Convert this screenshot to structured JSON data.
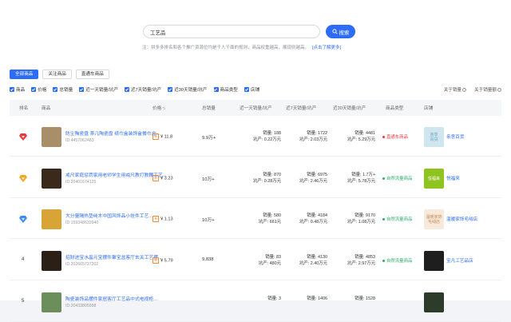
{
  "search": {
    "value": "工艺品",
    "button": "搜索"
  },
  "tip": {
    "text": "注：拼多多排名和各个推广资源位均是千人千面的规则，商品权重越高，展现则越高。",
    "link": "[点击了解更多]"
  },
  "tabs": [
    {
      "label": "全部商品",
      "active": true
    },
    {
      "label": "关注商品",
      "active": false
    },
    {
      "label": "直通车商品",
      "active": false
    }
  ],
  "filters": {
    "items": [
      "商品",
      "价格",
      "总销量",
      "近一天销量/坑产",
      "近7天销量/坑产",
      "近30天销量/坑产",
      "商品类型",
      "店铺"
    ],
    "right": [
      "关于销量",
      "关于销量额"
    ]
  },
  "table": {
    "headers": {
      "rank": "排名",
      "product": "商品",
      "price": "价格",
      "total": "总销量",
      "d1": "近一天销量/坑产",
      "d7": "近7天销量/坑产",
      "d30": "近30天销量/坑产",
      "type": "商品类型",
      "shop": "店铺"
    },
    "rows": [
      {
        "rank": "1",
        "rank_style": "red",
        "thumb_color": "#a98e6a",
        "title": "防尘陶瓷盘 茶几陶瓷盘 纸巾盒装饰盒餐巾盒...",
        "id": "ID:4457062483",
        "price_tag": "券",
        "price": "¥ 11.8",
        "total": "9.9万+",
        "d1_sales": "销量: 188",
        "d1_output": "坑产: 0.22万元",
        "d7_sales": "销量: 1722",
        "d7_output": "坑产: 2.03万元",
        "d30_sales": "销量: 4481",
        "d30_output": "坑产: 5.29万元",
        "type": "直通车商品",
        "type_color": "#e8383d",
        "shop_logo": "亲意\n百货",
        "shop_logo_bg": "#cfe6ef",
        "shop_logo_fg": "#6fa9c6",
        "shop": "亲意百货"
      },
      {
        "rank": "2",
        "rank_style": "orange",
        "thumb_color": "#3a2a1c",
        "title": "戒尺家庭惩罚家用老师学生用戒尺教打教鞭工艺...",
        "id": "ID:204016741​25",
        "price_tag": "券",
        "price": "¥ 3.23",
        "total": "10万+",
        "d1_sales": "销量: 870",
        "d1_output": "坑产: 0.28万元",
        "d7_sales": "销量: 6975",
        "d7_output": "坑产: 2.46万元",
        "d30_sales": "销量: 1.7万+",
        "d30_output": "坑产: 5.78万元",
        "type": "自然流量商品",
        "type_color": "#2fae6b",
        "shop_logo": "悦福来",
        "shop_logo_bg": "#8fc31f",
        "shop_logo_fg": "#ffffff",
        "shop": "悦福来"
      },
      {
        "rank": "3",
        "rank_style": "blue",
        "thumb_color": "#d9a436",
        "title": "大分量隔热垫纯木中国风饰品小挂件工艺...",
        "id": "ID:159348633940",
        "price_tag": "券",
        "price": "¥ 1.13",
        "total": "10万+",
        "d1_sales": "销量: 580",
        "d1_output": "坑产: 661元",
        "d7_sales": "销量: 4184",
        "d7_output": "坑产: 0.48万元",
        "d30_sales": "销量: 9170",
        "d30_output": "坑产: 1.08万元",
        "type": "自然流量商品",
        "type_color": "#2fae6b",
        "shop_logo": "温暖家饰\n毛绒店",
        "shop_logo_bg": "#f7e9dc",
        "shop_logo_fg": "#c98a5a",
        "shop": "温暖家饰毛绒店"
      },
      {
        "rank": "4",
        "rank_style": "plain",
        "thumb_color": "#2a2016",
        "title": "招财进宝水晶元宝摆件聚宝盆客厅玄关工艺摆...",
        "id": "ID:202665727202",
        "price_tag": "券",
        "price": "¥ 5.79",
        "total": "9,838",
        "d1_sales": "销量: 83",
        "d1_output": "坑产: 480元",
        "d7_sales": "销量: 4130",
        "d7_output": "坑产: 2.40万元",
        "d30_sales": "销量: 4853",
        "d30_output": "坑产: 2.97万元",
        "type": "自然流量商品",
        "type_color": "#2fae6b",
        "shop_logo": "",
        "shop_logo_bg": "#1e1e1e",
        "shop_logo_fg": "#ffffff",
        "shop": "宝凡工艺品店"
      },
      {
        "rank": "5",
        "rank_style": "plain",
        "thumb_color": "#6b8e5a",
        "title": "陶瓷装饰品摆件家居客厅工艺品中式电视柜...",
        "id": "ID:2​04338​05​99​8",
        "price_tag": "券",
        "price": "",
        "total": "",
        "d1_sales": "销量: 3",
        "d1_output": "",
        "d7_sales": "销量: 1406",
        "d7_output": "",
        "d30_sales": "销量: 1528",
        "d30_output": "",
        "type": "",
        "type_color": "#2fae6b",
        "shop_logo": "",
        "shop_logo_bg": "#2d3b2a",
        "shop_logo_fg": "#ffffff",
        "shop": ""
      }
    ]
  }
}
